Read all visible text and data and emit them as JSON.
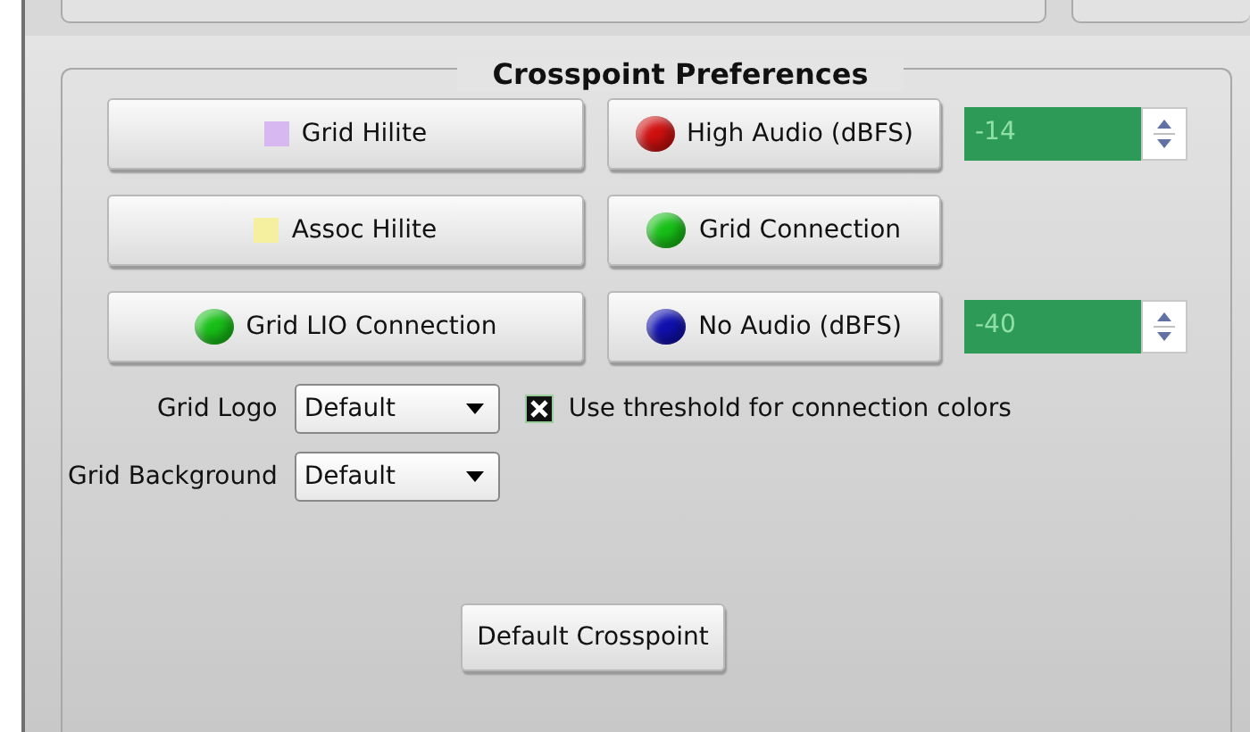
{
  "group": {
    "title": "Crosspoint Preferences"
  },
  "rows": [
    {
      "left": {
        "label": "Grid Hilite",
        "kind": "swatch",
        "color": "#d8b8f0"
      },
      "right": {
        "label": "High Audio (dBFS)",
        "kind": "led",
        "color": "#d01010"
      },
      "spinner": {
        "value": "-14"
      }
    },
    {
      "left": {
        "label": "Assoc Hilite",
        "kind": "swatch",
        "color": "#f4f0a0"
      },
      "right": {
        "label": "Grid Connection",
        "kind": "led",
        "color": "#18c018"
      }
    },
    {
      "left": {
        "label": "Grid LIO Connection",
        "kind": "led",
        "color": "#18c018"
      },
      "right": {
        "label": "No Audio (dBFS)",
        "kind": "led",
        "color": "#1010b0"
      },
      "spinner": {
        "value": "-40"
      }
    }
  ],
  "dropdowns": [
    {
      "label": "Grid Logo",
      "value": "Default"
    },
    {
      "label": "Grid Background",
      "value": "Default"
    }
  ],
  "checkbox": {
    "label": "Use threshold for connection colors",
    "checked": true
  },
  "default_button": "Default Crosspoint"
}
